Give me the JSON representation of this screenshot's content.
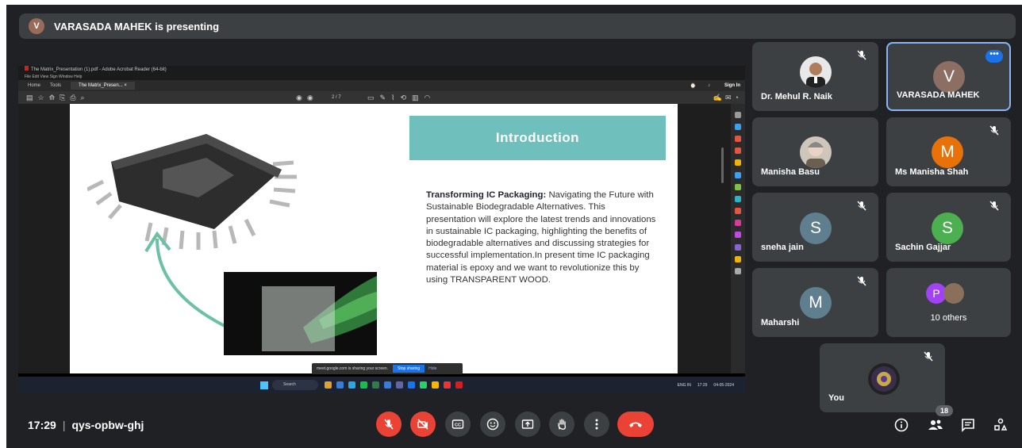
{
  "presenter_bar": {
    "avatar_initial": "V",
    "text": "VARASADA MAHEK is presenting"
  },
  "shared_screen": {
    "window_title": "The Matrix_Presentation (1).pdf - Adobe Acrobat Reader (64-bit)",
    "menu": "File  Edit  View  Sign  Window  Help",
    "tabs": [
      "Home",
      "Tools",
      "The Matrix_Presen...  ×"
    ],
    "sign_in": "Sign In",
    "page_indicator": "2 / 7",
    "slide": {
      "title": "Introduction",
      "lead_bold": "Transforming IC Packaging:",
      "lead_rest": " Navigating the Future with Sustainable Biodegradable Alternatives. This presentation will explore the latest trends and innovations in sustainable IC packaging, highlighting the benefits of biodegradable alternatives and discussing strategies for successful implementation.In present time IC packaging material is epoxy and we want to revolutionize this by using TRANSPARENT WOOD."
    },
    "share_notice": {
      "text": "meet.google.com is sharing your screen.",
      "stop": "Stop sharing",
      "hide": "Hide"
    },
    "taskbar": {
      "search": "Search",
      "lang": "ENG IN",
      "time": "17:29",
      "date": "04-05-2024"
    }
  },
  "participants": [
    {
      "name": "Dr. Mehul R. Naik",
      "type": "photo",
      "muted": true
    },
    {
      "name": "VARASADA MAHEK",
      "type": "initial",
      "initial": "V",
      "color": "#8d6e63",
      "speaking": true
    },
    {
      "name": "Manisha Basu",
      "type": "photo",
      "muted": false
    },
    {
      "name": "Ms Manisha Shah",
      "type": "initial",
      "initial": "M",
      "color": "#e8710a",
      "muted": true
    },
    {
      "name": "sneha jain",
      "type": "initial",
      "initial": "S",
      "color": "#5f7f8f",
      "muted": true
    },
    {
      "name": "Sachin Gajjar",
      "type": "initial",
      "initial": "S",
      "color": "#4caf50",
      "muted": true
    },
    {
      "name": "Maharshi",
      "type": "initial",
      "initial": "M",
      "color": "#5f7f8f",
      "muted": true
    },
    {
      "name": "10 others",
      "type": "group",
      "initial": "P",
      "color": "#a142f4"
    },
    {
      "name": "You",
      "type": "photo",
      "muted": true
    }
  ],
  "bottom_bar": {
    "time": "17:29",
    "separator": "|",
    "meeting_code": "qys-opbw-ghj",
    "participants_count": "18",
    "controls": [
      "mic-off",
      "camera-off",
      "captions",
      "emoji",
      "present",
      "raise-hand",
      "more",
      "leave-call"
    ]
  },
  "colors": {
    "background": "#202124",
    "tile": "#3c4043",
    "danger": "#ea4335",
    "accent": "#1a73e8",
    "teal": "#6fbfbc"
  }
}
